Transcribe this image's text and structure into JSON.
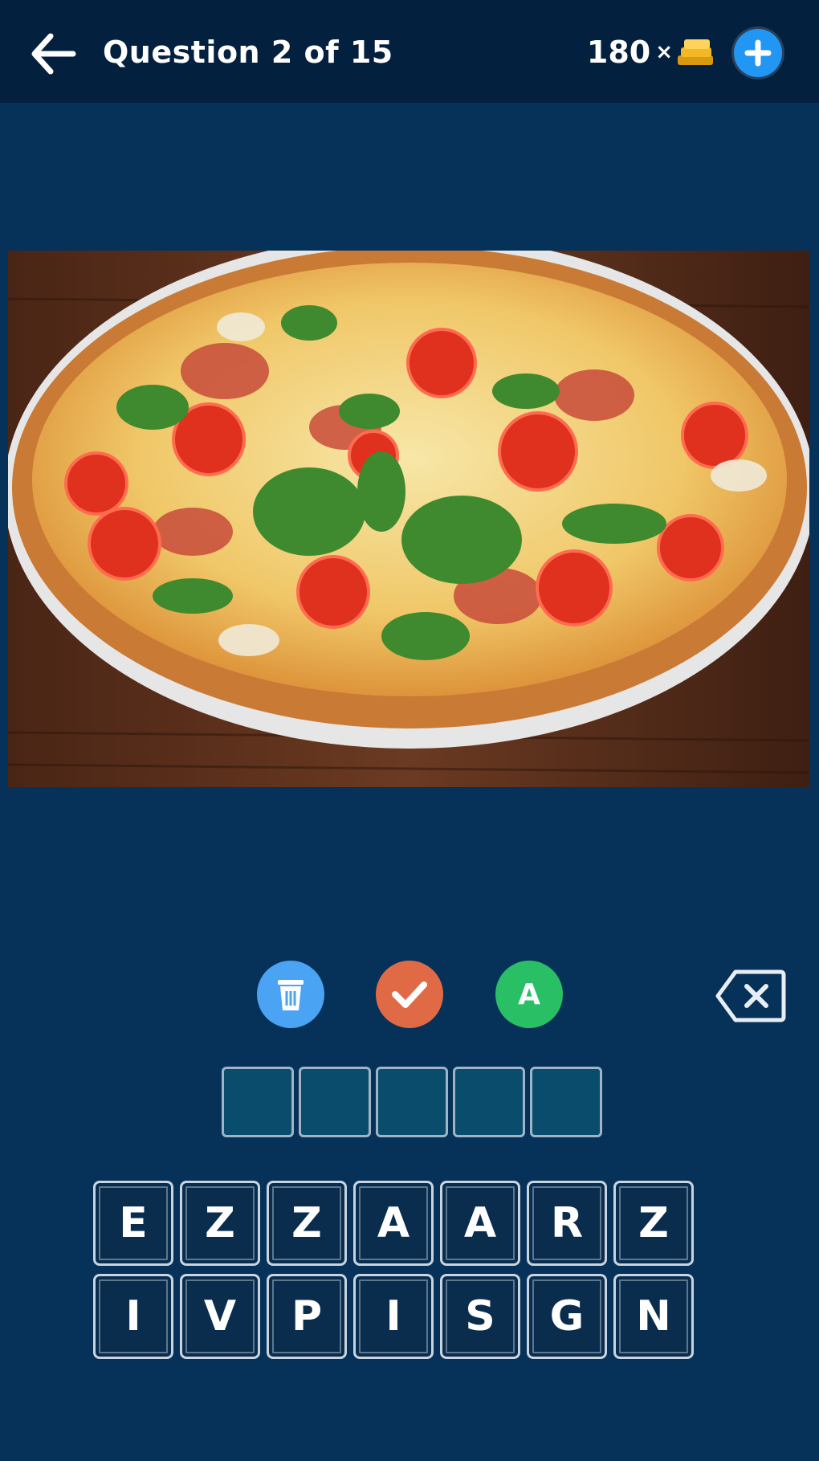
{
  "header": {
    "title": "Question 2 of 15",
    "coins": "180",
    "coins_multiplier": "×",
    "back_icon": "arrow-left-icon",
    "coin_icon": "coin-stack-icon",
    "add_icon": "plus-icon"
  },
  "image": {
    "subject": "pizza-photo"
  },
  "tools": {
    "bin_icon": "trash-bin-icon",
    "check_icon": "check-icon",
    "reveal_label": "A",
    "backspace_icon": "backspace-icon"
  },
  "answer": {
    "slots": [
      "",
      "",
      "",
      "",
      ""
    ]
  },
  "keyboard": {
    "row1": [
      "E",
      "Z",
      "Z",
      "A",
      "A",
      "R",
      "Z"
    ],
    "row2": [
      "I",
      "V",
      "P",
      "I",
      "S",
      "G",
      "N"
    ]
  },
  "colors": {
    "background": "#063158",
    "topbar": "#04203f",
    "add_button": "#2196f3",
    "bin_button": "#4aa3f3",
    "check_button": "#e06a45",
    "reveal_button": "#29c065",
    "coin": "#f4b826"
  }
}
